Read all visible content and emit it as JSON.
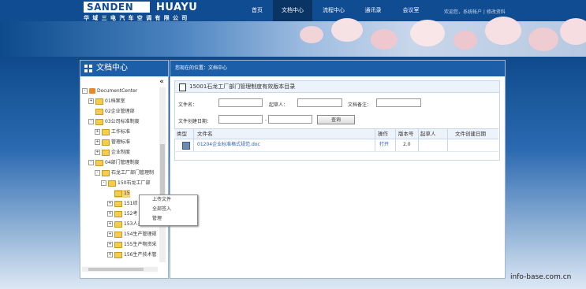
{
  "header": {
    "logo_left": "SANDEN",
    "logo_right": "HUAYU",
    "logo_sub": "华域三电汽车空调有限公司",
    "nav": [
      "首页",
      "文档中心",
      "流程中心",
      "通讯录",
      "会议室"
    ],
    "active_nav": 1,
    "user_info": "欢迎您，系统帐户 | 修改资料"
  },
  "sidebar": {
    "title": "文档中心",
    "collapse_label": "«",
    "tree": [
      {
        "label": "DocumentCenter",
        "toggle": "-",
        "icon": "root"
      },
      {
        "label": "01档案室",
        "toggle": "+",
        "icon": "folder"
      },
      {
        "label": "02企业管理部",
        "toggle": "",
        "icon": "folder"
      },
      {
        "label": "03公司标准制度",
        "toggle": "-",
        "icon": "folder"
      },
      {
        "label": "工作标准",
        "toggle": "+",
        "icon": "folder"
      },
      {
        "label": "管理标准",
        "toggle": "+",
        "icon": "folder"
      },
      {
        "label": "企业制度",
        "toggle": "+",
        "icon": "folder"
      },
      {
        "label": "04部门管理制度",
        "toggle": "-",
        "icon": "folder"
      },
      {
        "label": "石龙工厂部门管理制",
        "toggle": "-",
        "icon": "folder"
      },
      {
        "label": "150石龙工厂部",
        "toggle": "-",
        "icon": "folder"
      },
      {
        "label": "15",
        "toggle": "",
        "icon": "folder"
      },
      {
        "label": "151综",
        "toggle": "+",
        "icon": "folder"
      },
      {
        "label": "152考",
        "toggle": "+",
        "icon": "folder"
      },
      {
        "label": "153人员管理规",
        "toggle": "+",
        "icon": "folder"
      },
      {
        "label": "154生产管理规",
        "toggle": "+",
        "icon": "folder"
      },
      {
        "label": "155生产物资采",
        "toggle": "+",
        "icon": "folder"
      },
      {
        "label": "156生产技术管",
        "toggle": "+",
        "icon": "folder"
      }
    ]
  },
  "context_menu": [
    "上传文件",
    "全部签入",
    "管理"
  ],
  "main": {
    "breadcrumb": "您现在的位置：文档中心",
    "folder_title": "15001石龙工厂部门管理制度有效版本目录",
    "search": {
      "file_name_label": "文件名：",
      "author_label": "起草人：",
      "remark_label": "文档备注：",
      "date_label": "文件创建日期：",
      "date_sep": "-",
      "query_button": "查询"
    },
    "columns": [
      "类型",
      "文件名",
      "操作",
      "版本号",
      "起草人",
      "文件创建日期"
    ],
    "rows": [
      {
        "type_icon": "doc-icon",
        "name": "01204企业标准格式规范.doc",
        "action": "打开",
        "version": "2.0",
        "author": "",
        "date": ""
      }
    ]
  },
  "watermark": "info-base.com.cn"
}
